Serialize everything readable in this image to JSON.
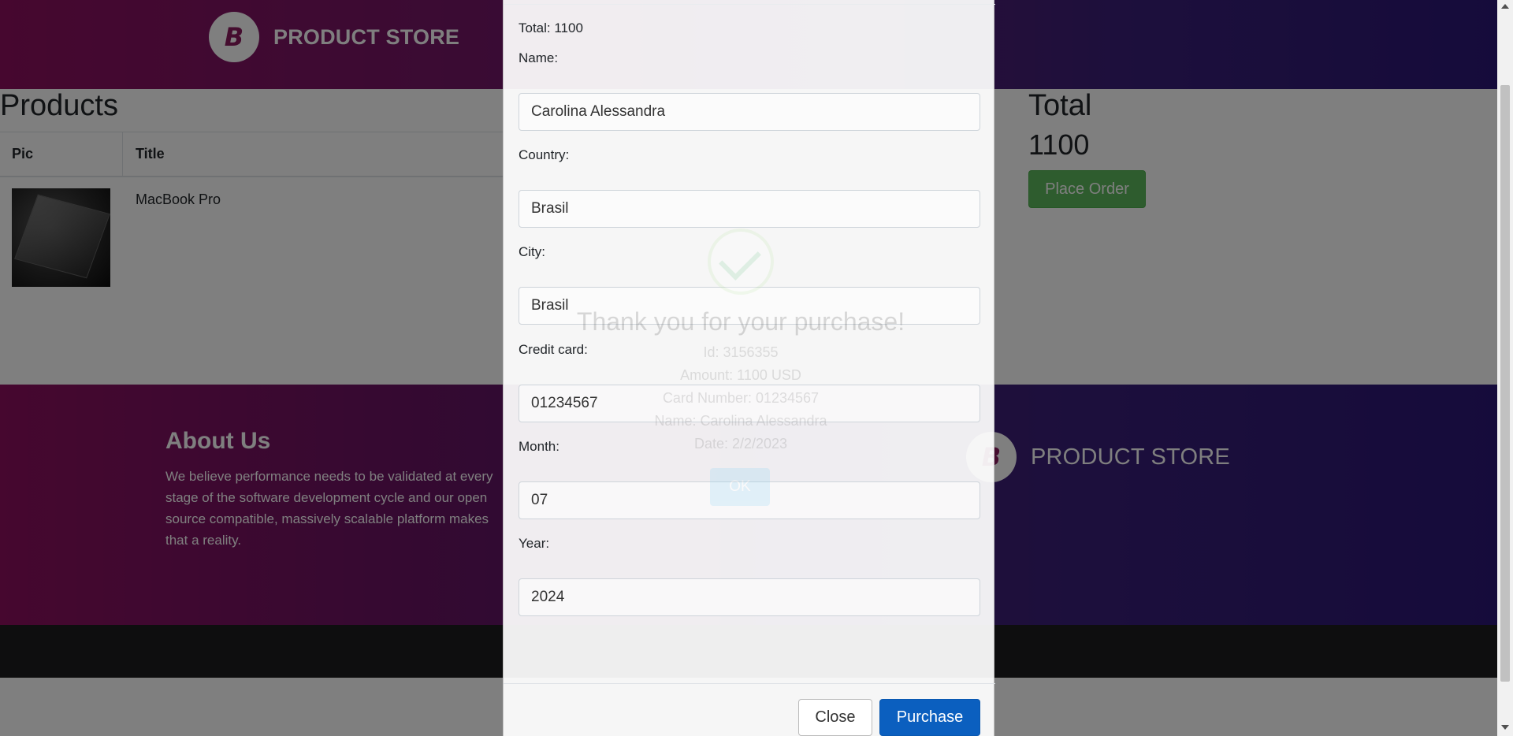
{
  "navbar": {
    "brand_logo_letter": "B",
    "brand_name": "PRODUCT STORE"
  },
  "products": {
    "title": "Products",
    "columns": [
      "Pic",
      "Title"
    ],
    "rows": [
      {
        "title": "MacBook Pro"
      }
    ]
  },
  "summary": {
    "title": "Total",
    "value": "1100",
    "place_order_label": "Place Order"
  },
  "footer": {
    "about_title": "About Us",
    "about_text": "We believe performance needs to be validated at every stage of the software development cycle and our open source compatible, massively scalable platform makes that a reality.",
    "brand_logo_letter": "B",
    "brand_name": "PRODUCT STORE"
  },
  "sweet_alert": {
    "title": "Thank you for your purchase!",
    "lines": [
      "Id: 3156355",
      "Amount: 1100 USD",
      "Card Number: 01234567",
      "Name: Carolina Alessandra",
      "Date: 2/2/2023"
    ],
    "ok_label": "OK"
  },
  "order_modal": {
    "total_text": "Total: 1100",
    "fields": [
      {
        "label": "Name:",
        "value": "Carolina Alessandra"
      },
      {
        "label": "Country:",
        "value": "Brasil"
      },
      {
        "label": "City:",
        "value": "Brasil"
      },
      {
        "label": "Credit card:",
        "value": "01234567"
      },
      {
        "label": "Month:",
        "value": "07"
      },
      {
        "label": "Year:",
        "value": "2024"
      }
    ],
    "close_label": "Close",
    "purchase_label": "Purchase"
  }
}
